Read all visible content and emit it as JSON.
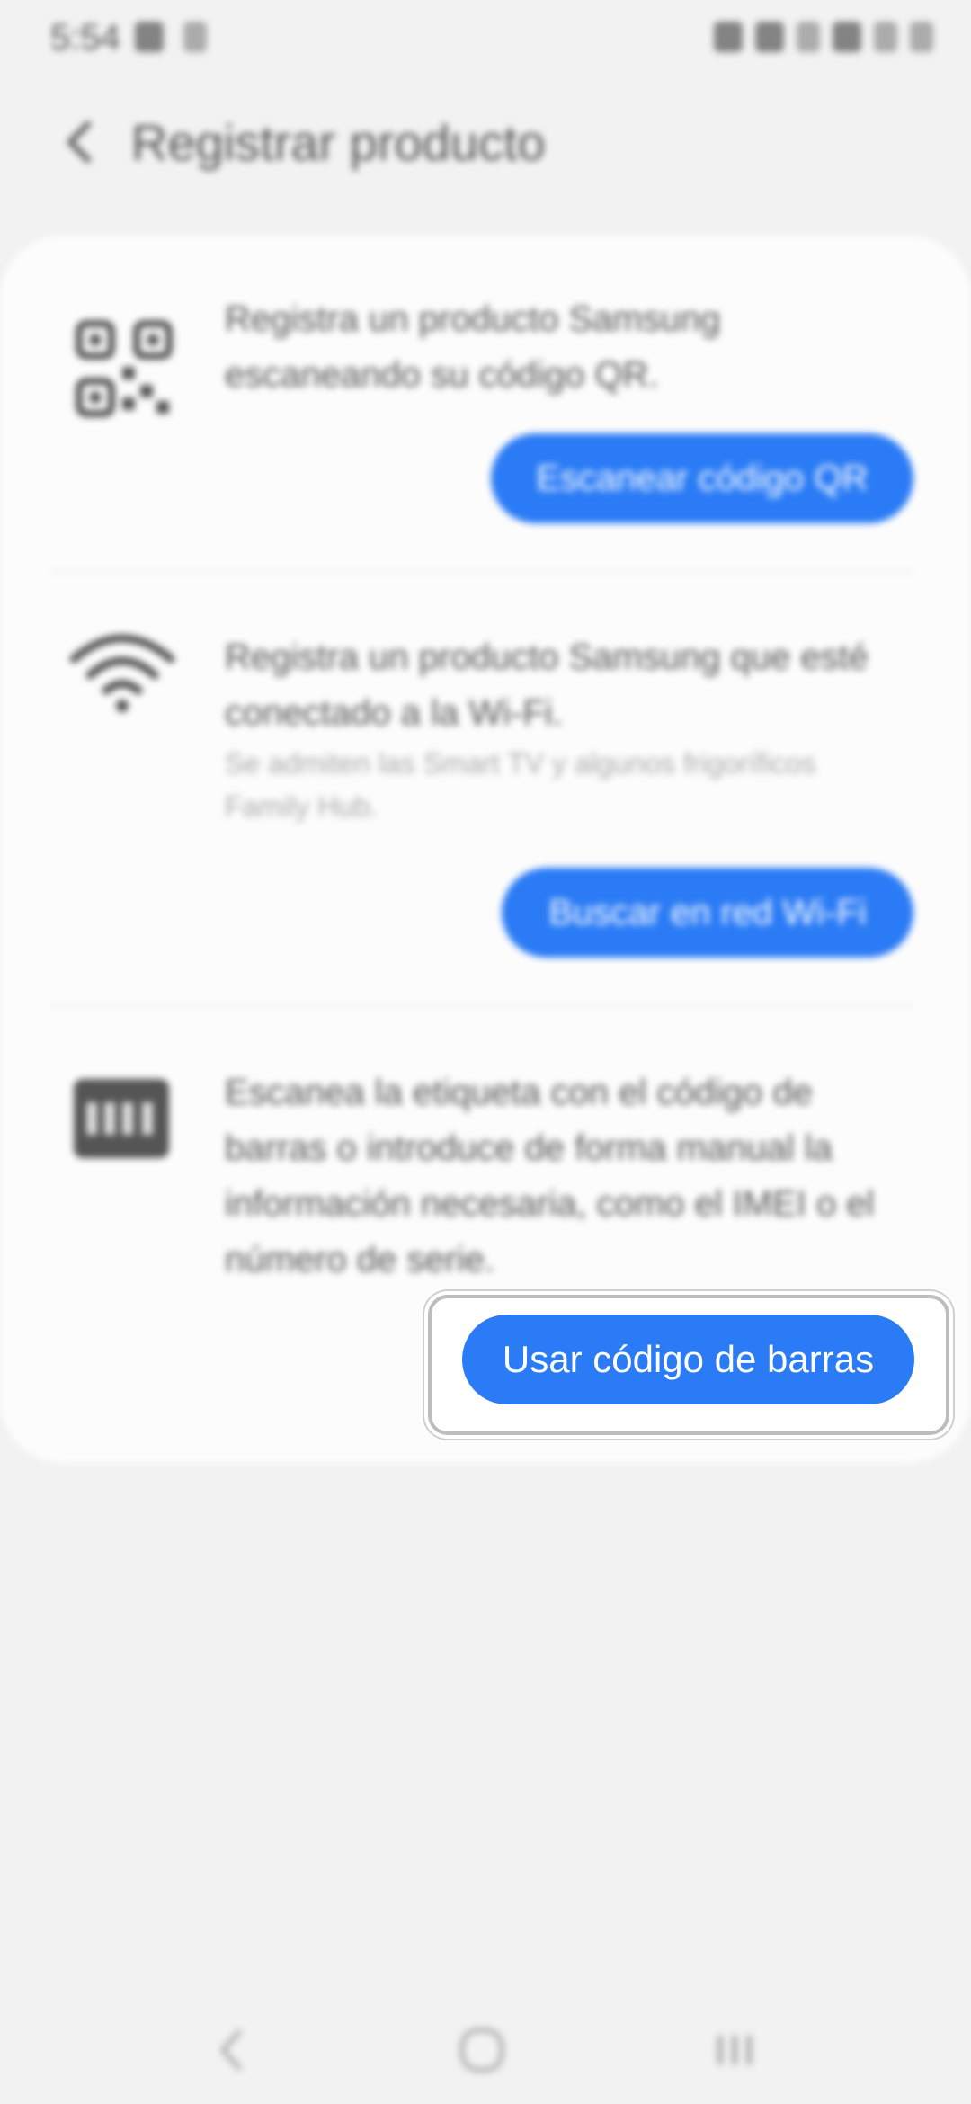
{
  "status_bar": {
    "time": "5:54",
    "left_icons": [
      "image-icon",
      "music-note-icon"
    ],
    "right_icons": [
      "nfc-icon",
      "mute-icon",
      "wifi-icon",
      "data-icon",
      "signal-icon",
      "battery-icon"
    ]
  },
  "header": {
    "title": "Registrar producto",
    "back_icon": "chevron-left-icon"
  },
  "sections": [
    {
      "icon": "qr-code-icon",
      "text": "Registra un producto Samsung escaneando su código QR.",
      "button_label": "Escanear código QR"
    },
    {
      "icon": "wifi-icon",
      "text": "Registra un producto Samsung que esté conectado a la Wi-Fi.",
      "subtext": "Se admiten las Smart TV y algunos frigoríficos Family Hub.",
      "button_label": "Buscar en red Wi-Fi"
    },
    {
      "icon": "barcode-icon",
      "text": "Escanea la etiqueta con el código de barras o introduce de forma manual la información necesaria, como el IMEI o el número de serie.",
      "button_label": "Usar código de barras"
    }
  ],
  "nav_bar": {
    "back": "nav-back-icon",
    "home": "nav-home-icon",
    "recents": "nav-recents-icon"
  },
  "colors": {
    "accent": "#2a7bf5",
    "background": "#f2f2f2",
    "card": "#fcfcfc"
  }
}
